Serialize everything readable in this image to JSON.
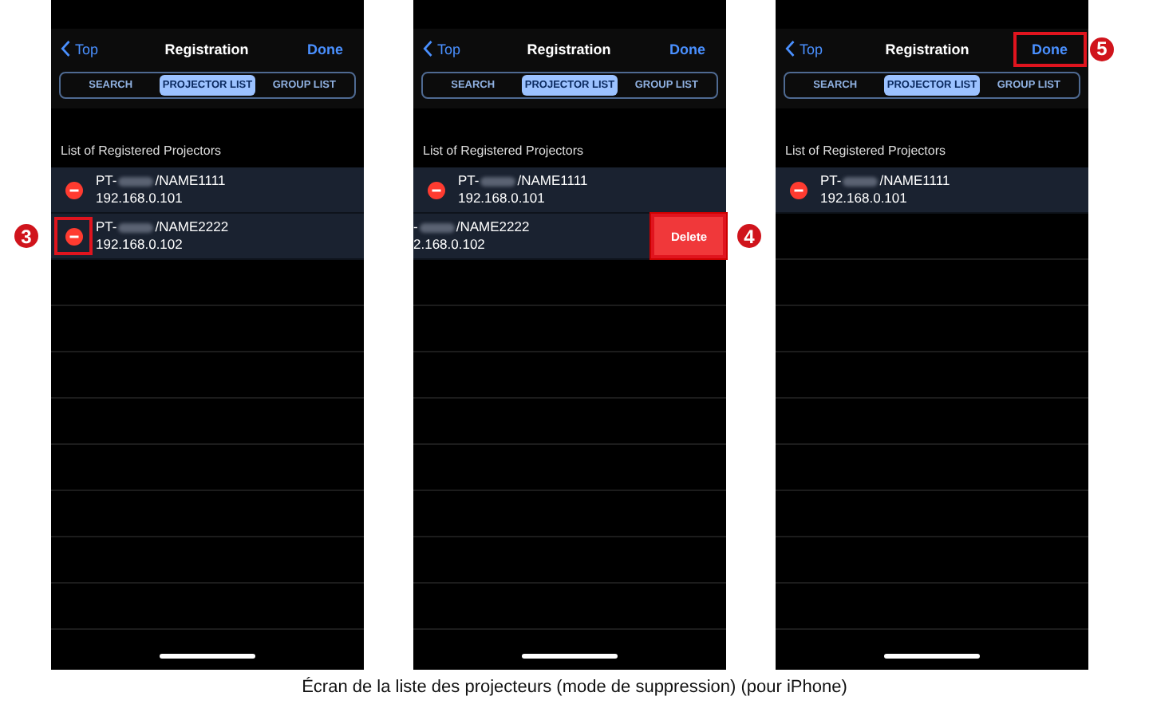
{
  "screens": [
    {
      "nav": {
        "back": "Top",
        "title": "Registration",
        "done": "Done"
      },
      "tabs": [
        {
          "label": "SEARCH",
          "selected": false
        },
        {
          "label": "PROJECTOR LIST",
          "selected": true
        },
        {
          "label": "GROUP LIST",
          "selected": false
        }
      ],
      "section_header": "List of Registered Projectors",
      "rows": [
        {
          "name_prefix": "PT-",
          "name_suffix": "/NAME1111",
          "ip": "192.168.0.101",
          "swiped": false
        },
        {
          "name_prefix": "PT-",
          "name_suffix": "/NAME2222",
          "ip": "192.168.0.102",
          "swiped": false,
          "callout": "3"
        }
      ]
    },
    {
      "nav": {
        "back": "Top",
        "title": "Registration",
        "done": "Done"
      },
      "tabs": [
        {
          "label": "SEARCH",
          "selected": false
        },
        {
          "label": "PROJECTOR LIST",
          "selected": true
        },
        {
          "label": "GROUP LIST",
          "selected": false
        }
      ],
      "section_header": "List of Registered Projectors",
      "rows": [
        {
          "name_prefix": "PT-",
          "name_suffix": "/NAME1111",
          "ip": "192.168.0.101",
          "swiped": false
        },
        {
          "name_prefix": "-",
          "name_suffix": "/NAME2222",
          "ip": "2.168.0.102",
          "swiped": true,
          "delete_label": "Delete",
          "callout": "4"
        }
      ]
    },
    {
      "nav": {
        "back": "Top",
        "title": "Registration",
        "done": "Done",
        "callout": "5"
      },
      "tabs": [
        {
          "label": "SEARCH",
          "selected": false
        },
        {
          "label": "PROJECTOR LIST",
          "selected": true
        },
        {
          "label": "GROUP LIST",
          "selected": false
        }
      ],
      "section_header": "List of Registered Projectors",
      "rows": [
        {
          "name_prefix": "PT-",
          "name_suffix": "/NAME1111",
          "ip": "192.168.0.101",
          "swiped": false
        }
      ]
    }
  ],
  "caption": "Écran de la liste des projecteurs (mode de suppression) (pour iPhone)"
}
